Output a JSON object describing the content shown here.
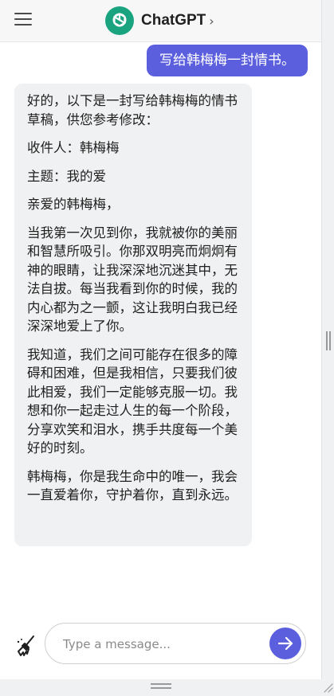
{
  "header": {
    "title": "ChatGPT",
    "chevron": "›",
    "menu_icon": "hamburger-icon",
    "logo_icon": "openai-logo-icon"
  },
  "conversation": {
    "user_message": "写给韩梅梅一封情书。",
    "assistant_paragraphs": [
      "好的，以下是一封写给韩梅梅的情书草稿，供您参考修改：",
      "收件人：韩梅梅",
      "主题：我的爱",
      "亲爱的韩梅梅，",
      "当我第一次见到你，我就被你的美丽和智慧所吸引。你那双明亮而炯炯有神的眼睛，让我深深地沉迷其中，无法自拔。每当我看到你的时候，我的内心都为之一颤，这让我明白我已经深深地爱上了你。",
      "我知道，我们之间可能存在很多的障碍和困难，但是我相信，只要我们彼此相爱，我们一定能够克服一切。我想和你一起走过人生的每一个阶段，分享欢笑和泪水，携手共度每一个美好的时刻。",
      "韩梅梅，你是我生命中的唯一，我会一直爱着你，守护着你，直到永远。"
    ]
  },
  "composer": {
    "placeholder": "Type a message...",
    "value": "",
    "clear_icon": "broom-icon",
    "send_icon": "arrow-right-icon"
  },
  "colors": {
    "accent": "#5b5fde",
    "logo_green": "#19a37f",
    "bot_bubble": "#f0f1f2",
    "header_bg": "#f7f7f8"
  }
}
